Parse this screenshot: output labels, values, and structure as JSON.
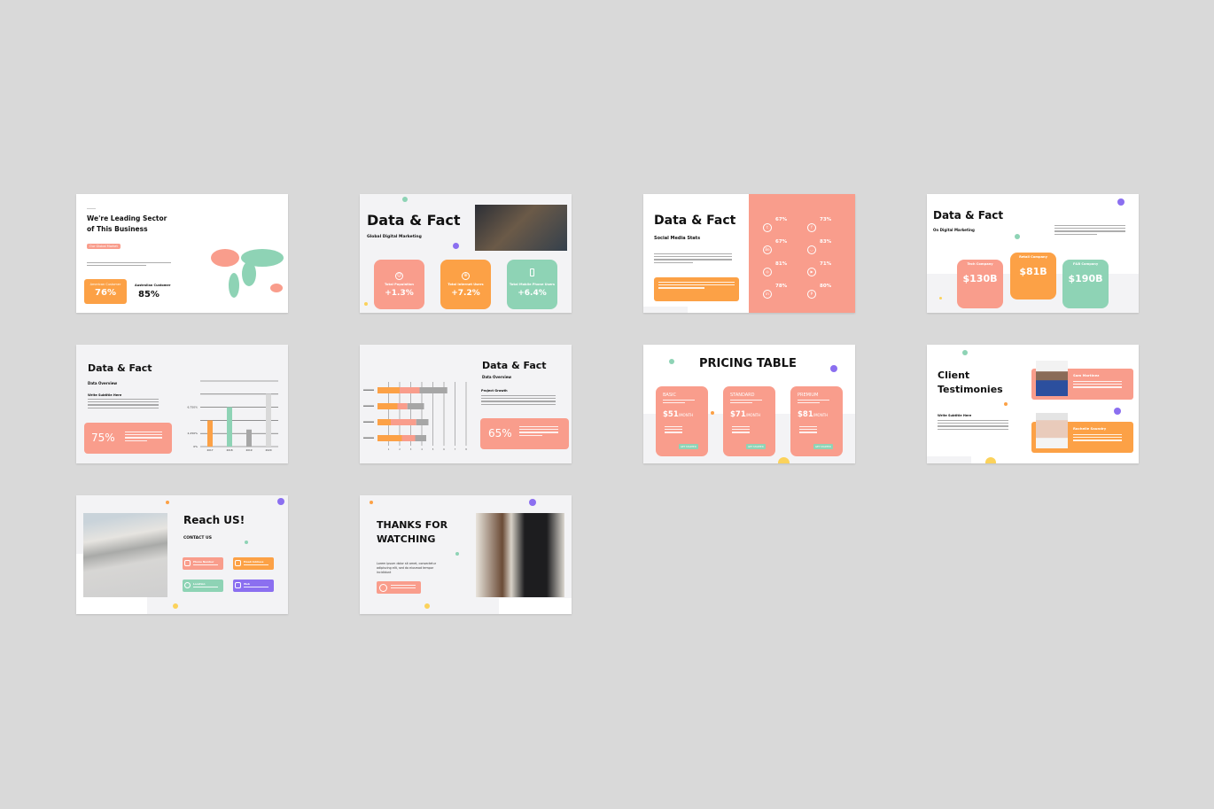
{
  "colors": {
    "salmon": "#F99D8C",
    "orange": "#FCA146",
    "mint": "#8ED3B5",
    "purple": "#8B6FF0",
    "yellow": "#FBD25B",
    "gray": "#A6A6A6",
    "lightgray": "#D9D9D9"
  },
  "slide1": {
    "title_line1": "We're Leading Sector",
    "title_line2": "of This Business",
    "badge": "Our Global Market",
    "stat1_label": "American Customer",
    "stat1_value": "76%",
    "stat2_label": "Australian Customer",
    "stat2_value": "85%"
  },
  "slide2": {
    "title": "Data & Fact",
    "subtitle": "Global Digital Marketing",
    "cards": [
      {
        "icon": "user-icon",
        "label": "Total Population",
        "value": "+1.3%"
      },
      {
        "icon": "globe-icon",
        "label": "Total Internet Users",
        "value": "+7.2%"
      },
      {
        "icon": "phone-icon",
        "label": "Total Mobile Phone Users",
        "value": "+6.4%"
      }
    ]
  },
  "slide3": {
    "title": "Data & Fact",
    "subtitle": "Social Media Stats",
    "stats": [
      {
        "icon": "twitter-icon",
        "value": "67%"
      },
      {
        "icon": "facebook-icon",
        "value": "73%"
      },
      {
        "icon": "behance-icon",
        "value": "67%"
      },
      {
        "icon": "dribbble-icon",
        "value": "83%"
      },
      {
        "icon": "instagram-icon",
        "value": "81%"
      },
      {
        "icon": "youtube-icon",
        "value": "71%"
      },
      {
        "icon": "linkedin-icon",
        "value": "78%"
      },
      {
        "icon": "pinterest-icon",
        "value": "80%"
      }
    ]
  },
  "slide4": {
    "title": "Data & Fact",
    "subtitle": "On Digital Marketing",
    "cards": [
      {
        "label": "Tech Company",
        "value": "$130B"
      },
      {
        "label": "Retail Company",
        "value": "$81B"
      },
      {
        "label": "F&B Company",
        "value": "$190B"
      }
    ]
  },
  "slide5": {
    "title": "Data & Fact",
    "subtitle": "Data Overview",
    "heading": "Write Subtitle Here",
    "stat": "75%"
  },
  "slide6": {
    "title": "Data & Fact",
    "subtitle": "Data Overview",
    "heading": "Project Growth",
    "stat": "65%"
  },
  "chart_data": [
    {
      "type": "bar",
      "categories": [
        "2017",
        "2018",
        "2019",
        "2020"
      ],
      "values": [
        2,
        3,
        1.3,
        4
      ],
      "ytick_labels": [
        "0%",
        "2,250%",
        "6,750%"
      ],
      "ylim": [
        0,
        5
      ],
      "grid": true,
      "colors": [
        "#FCA146",
        "#8ED3B5",
        "#A6A6A6",
        "#D9D9D9"
      ]
    },
    {
      "type": "bar",
      "orientation": "horizontal",
      "stacked": true,
      "xticks": [
        1,
        2,
        3,
        4,
        5,
        6,
        7,
        8
      ],
      "xlim": [
        0,
        8
      ],
      "grid": true,
      "series": [
        {
          "color": "#FCA146",
          "values": [
            2,
            1.8,
            1.2,
            2.2
          ]
        },
        {
          "color": "#F99D8C",
          "values": [
            1.8,
            0.9,
            2.3,
            1.2
          ]
        },
        {
          "color": "#A6A6A6",
          "values": [
            2.5,
            1.5,
            1.1,
            1.0
          ]
        }
      ]
    }
  ],
  "slide7": {
    "title": "PRICING TABLE",
    "plans": [
      {
        "name": "BASIC",
        "price": "$51",
        "per": "/MONTH",
        "button": "GET STARTED"
      },
      {
        "name": "STANDARD",
        "price": "$71",
        "per": "/MONTH",
        "button": "GET STARTED"
      },
      {
        "name": "PREMIUM",
        "price": "$81",
        "per": "/MONTH",
        "button": "GET STARTED"
      }
    ]
  },
  "slide8": {
    "title_line1": "Client",
    "title_line2": "Testimonies",
    "heading": "Write Subtitle Here",
    "people": [
      {
        "name": "Sam Martinez"
      },
      {
        "name": "Rachelle Saundry"
      }
    ]
  },
  "slide9": {
    "title": "Reach US!",
    "subtitle": "CONTACT US",
    "contacts": [
      {
        "icon": "phone-icon",
        "label": "Phone Number"
      },
      {
        "icon": "mail-icon",
        "label": "Email Address"
      },
      {
        "icon": "location-icon",
        "label": "Location"
      },
      {
        "icon": "web-icon",
        "label": "Web"
      }
    ]
  },
  "slide10": {
    "title_line1": "THANKS FOR",
    "title_line2": "WATCHING",
    "body": "Lorem ipsum dolor sit amet, consectetur adipiscing elit, sed do eiusmod tempor incididunt"
  }
}
